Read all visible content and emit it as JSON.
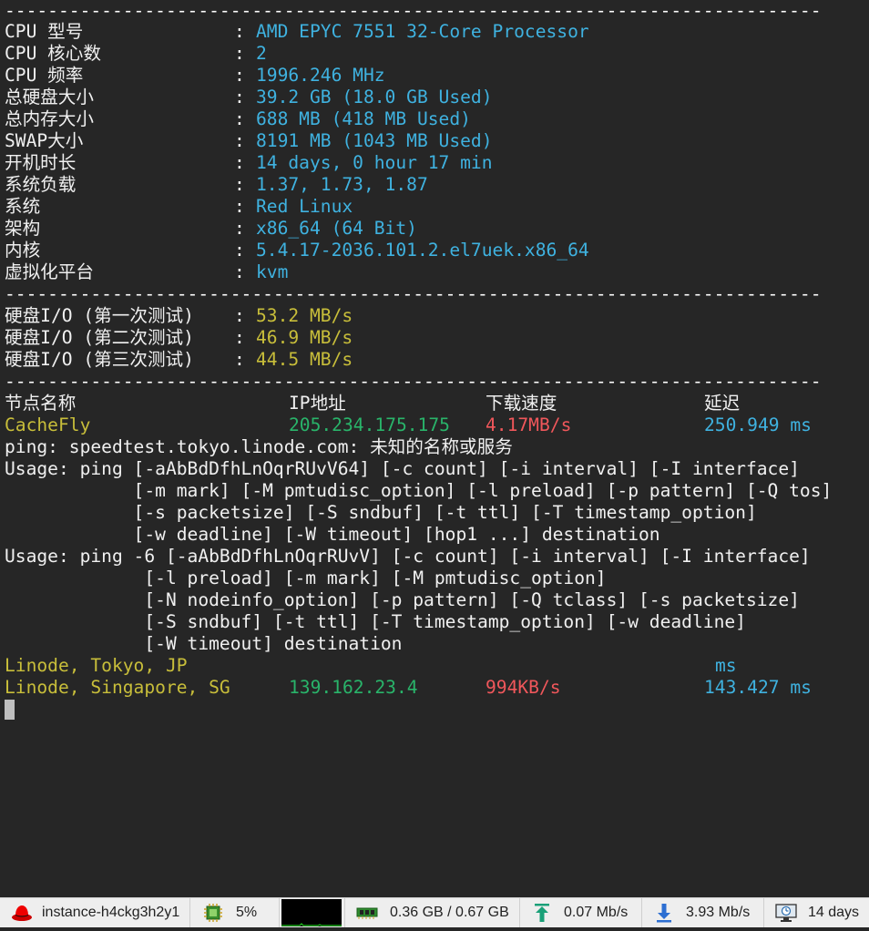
{
  "separator": "----------------------------------------------------------------------------",
  "sysinfo": [
    {
      "label": "CPU 型号",
      "value": "AMD EPYC 7551 32-Core Processor"
    },
    {
      "label": "CPU 核心数",
      "value": "2"
    },
    {
      "label": "CPU 频率",
      "value": "1996.246 MHz"
    },
    {
      "label": "总硬盘大小",
      "value": "39.2 GB (18.0 GB Used)"
    },
    {
      "label": "总内存大小",
      "value": "688 MB (418 MB Used)"
    },
    {
      "label": "SWAP大小",
      "value": "8191 MB (1043 MB Used)"
    },
    {
      "label": "开机时长",
      "value": "14 days, 0 hour 17 min"
    },
    {
      "label": "系统负载",
      "value": "1.37, 1.73, 1.87"
    },
    {
      "label": "系统",
      "value": "Red Linux"
    },
    {
      "label": "架构",
      "value": "x86_64 (64 Bit)"
    },
    {
      "label": "内核",
      "value": "5.4.17-2036.101.2.el7uek.x86_64"
    },
    {
      "label": "虚拟化平台",
      "value": "kvm"
    }
  ],
  "colon": ":",
  "disk_io": [
    {
      "label": "硬盘I/O (第一次测试)",
      "value": "53.2 MB/s"
    },
    {
      "label": "硬盘I/O (第二次测试)",
      "value": "46.9 MB/s"
    },
    {
      "label": "硬盘I/O (第三次测试)",
      "value": "44.5 MB/s"
    }
  ],
  "speed_headers": {
    "node": "节点名称",
    "ip": "IP地址",
    "speed": "下载速度",
    "latency": "延迟"
  },
  "speed_row_cachefly": {
    "node": "CacheFly",
    "ip": "205.234.175.175",
    "speed": "4.17MB/s",
    "latency": "250.949 ms"
  },
  "ping_error": "ping: speedtest.tokyo.linode.com: 未知的名称或服务",
  "usage_lines": [
    "Usage: ping [-aAbBdDfhLnOqrRUvV64] [-c count] [-i interval] [-I interface]",
    "            [-m mark] [-M pmtudisc_option] [-l preload] [-p pattern] [-Q tos]",
    "            [-s packetsize] [-S sndbuf] [-t ttl] [-T timestamp_option]",
    "            [-w deadline] [-W timeout] [hop1 ...] destination",
    "Usage: ping -6 [-aAbBdDfhLnOqrRUvV] [-c count] [-i interval] [-I interface]",
    "             [-l preload] [-m mark] [-M pmtudisc_option]",
    "             [-N nodeinfo_option] [-p pattern] [-Q tclass] [-s packetsize]",
    "             [-S sndbuf] [-t ttl] [-T timestamp_option] [-w deadline]",
    "             [-W timeout] destination"
  ],
  "speed_row_tokyo": {
    "node": "Linode, Tokyo, JP",
    "latency": "ms"
  },
  "speed_row_singapore": {
    "node": "Linode, Singapore, SG",
    "ip": "139.162.23.4",
    "speed": "994KB/s",
    "latency": "143.427 ms"
  },
  "statusbar": {
    "instance": "instance-h4ckg3h2y1",
    "cpu": "5%",
    "memory": "0.36 GB / 0.67 GB",
    "upload": "0.07 Mb/s",
    "download": "3.93 Mb/s",
    "uptime": "14 days"
  },
  "colors": {
    "background": "#262626",
    "value_cyan": "#3fb2e0",
    "value_yellow": "#c8be3a",
    "ip_green": "#29b46a",
    "speed_red": "#f0575b"
  },
  "icons": {
    "instance": "redhat-hat-icon",
    "cpu": "cpu-chip-icon",
    "memory": "ram-stick-icon",
    "upload": "upload-arrow-icon",
    "download": "download-arrow-icon",
    "uptime": "monitor-clock-icon"
  }
}
